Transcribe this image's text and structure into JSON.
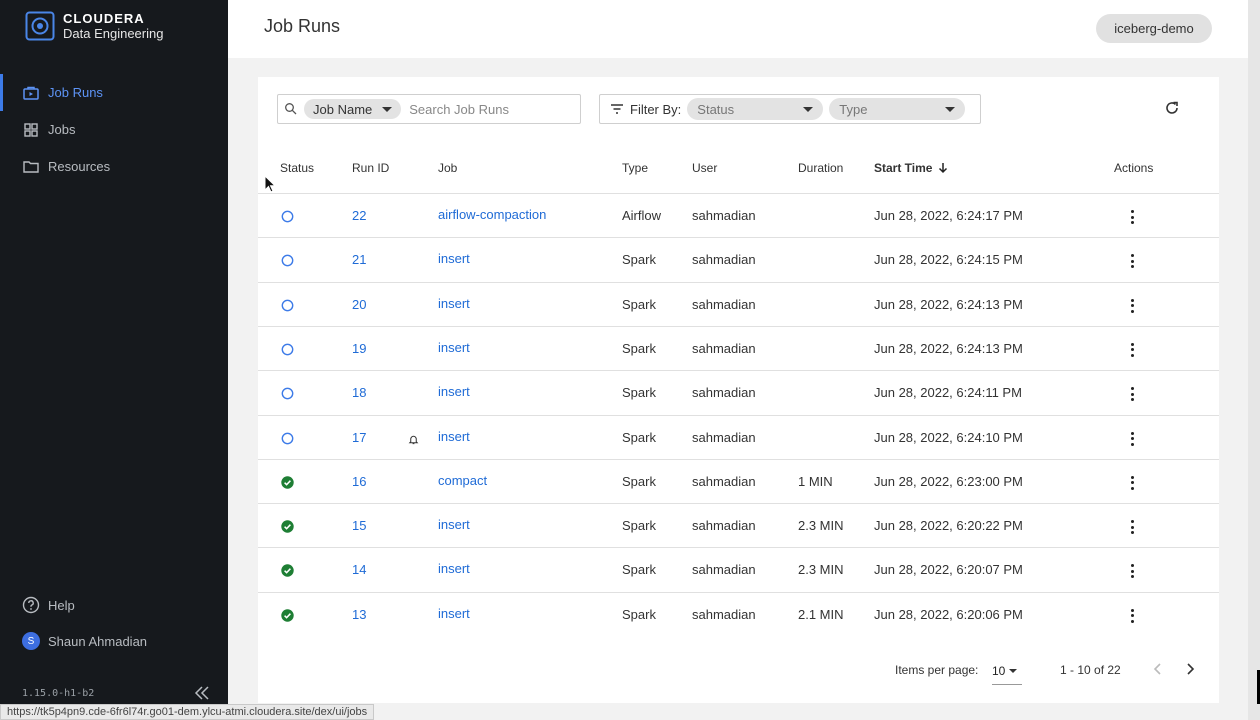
{
  "sidebar": {
    "brand_name": "CLOUDERA",
    "brand_sub": "Data Engineering",
    "items": [
      {
        "label": "Job Runs",
        "icon": "job-runs-icon",
        "active": true
      },
      {
        "label": "Jobs",
        "icon": "grid-icon",
        "active": false
      },
      {
        "label": "Resources",
        "icon": "folder-icon",
        "active": false
      }
    ],
    "help_label": "Help",
    "user_initial": "S",
    "user_name": "Shaun Ahmadian",
    "version": "1.15.0-h1-b2"
  },
  "header": {
    "title": "Job Runs",
    "environment": "iceberg-demo"
  },
  "toolbar": {
    "search_field_chip": "Job Name",
    "search_placeholder": "Search Job Runs",
    "filter_label": "Filter By:",
    "status_placeholder": "Status",
    "type_placeholder": "Type"
  },
  "table": {
    "columns": {
      "status": "Status",
      "run_id": "Run ID",
      "job": "Job",
      "type": "Type",
      "user": "User",
      "duration": "Duration",
      "start_time": "Start Time",
      "actions": "Actions"
    },
    "sort_column": "Start Time",
    "sort_direction": "descending",
    "rows": [
      {
        "status": "running",
        "run_id": "22",
        "job": "airflow-compaction",
        "type": "Airflow",
        "user": "sahmadian",
        "duration": "",
        "start_time": "Jun 28, 2022, 6:24:17 PM",
        "alert": false
      },
      {
        "status": "running",
        "run_id": "21",
        "job": "insert",
        "type": "Spark",
        "user": "sahmadian",
        "duration": "",
        "start_time": "Jun 28, 2022, 6:24:15 PM",
        "alert": false
      },
      {
        "status": "running",
        "run_id": "20",
        "job": "insert",
        "type": "Spark",
        "user": "sahmadian",
        "duration": "",
        "start_time": "Jun 28, 2022, 6:24:13 PM",
        "alert": false
      },
      {
        "status": "running",
        "run_id": "19",
        "job": "insert",
        "type": "Spark",
        "user": "sahmadian",
        "duration": "",
        "start_time": "Jun 28, 2022, 6:24:13 PM",
        "alert": false
      },
      {
        "status": "running",
        "run_id": "18",
        "job": "insert",
        "type": "Spark",
        "user": "sahmadian",
        "duration": "",
        "start_time": "Jun 28, 2022, 6:24:11 PM",
        "alert": false
      },
      {
        "status": "running",
        "run_id": "17",
        "job": "insert",
        "type": "Spark",
        "user": "sahmadian",
        "duration": "",
        "start_time": "Jun 28, 2022, 6:24:10 PM",
        "alert": true
      },
      {
        "status": "succeeded",
        "run_id": "16",
        "job": "compact",
        "type": "Spark",
        "user": "sahmadian",
        "duration": "1 MIN",
        "start_time": "Jun 28, 2022, 6:23:00 PM",
        "alert": false
      },
      {
        "status": "succeeded",
        "run_id": "15",
        "job": "insert",
        "type": "Spark",
        "user": "sahmadian",
        "duration": "2.3 MIN",
        "start_time": "Jun 28, 2022, 6:20:22 PM",
        "alert": false
      },
      {
        "status": "succeeded",
        "run_id": "14",
        "job": "insert",
        "type": "Spark",
        "user": "sahmadian",
        "duration": "2.3 MIN",
        "start_time": "Jun 28, 2022, 6:20:07 PM",
        "alert": false
      },
      {
        "status": "succeeded",
        "run_id": "13",
        "job": "insert",
        "type": "Spark",
        "user": "sahmadian",
        "duration": "2.1 MIN",
        "start_time": "Jun 28, 2022, 6:20:06 PM",
        "alert": false
      }
    ]
  },
  "pagination": {
    "items_per_page_label": "Items per page:",
    "items_per_page": "10",
    "range": "1 - 10 of 22"
  },
  "browser": {
    "status_url": "https://tk5p4pn9.cde-6fr6l74r.go01-dem.ylcu-atmi.cloudera.site/dex/ui/jobs"
  },
  "colors": {
    "sidebar_bg": "#16191d",
    "accent": "#3d7be8",
    "link": "#1f6bd6",
    "running": "#3d7be8",
    "succeeded": "#1e7e34"
  }
}
